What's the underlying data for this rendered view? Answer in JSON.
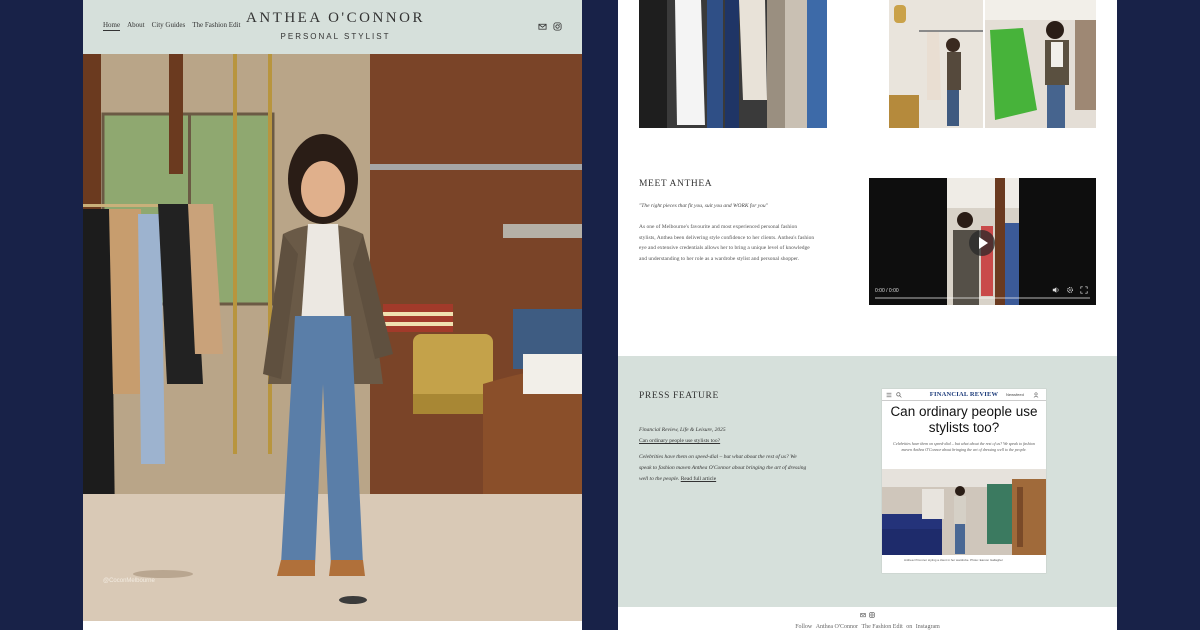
{
  "header": {
    "nav": [
      "Home",
      "About",
      "City Guides",
      "The Fashion Edit"
    ],
    "active_nav": "Home",
    "brand_name": "ANTHEA O'CONNOR",
    "brand_subtitle": "PERSONAL STYLIST",
    "icons": [
      "email-icon",
      "instagram-icon"
    ]
  },
  "hero": {
    "caption": "@CoconMelbourne"
  },
  "meet": {
    "heading": "MEET ANTHEA",
    "quote": "\"The right pieces that fit you, suit you and WORK for you\"",
    "bio": "As one of Melbourne's favourite and most experienced personal fashion stylists, Anthea been delivering style confidence to her clients. Anthea's fashion eye and extensive credentials allows her to bring a unique level of knowledge and understanding to her role as a wardrobe stylist and personal shopper."
  },
  "video": {
    "time": "0:00 / 0:00",
    "progress": 0.0
  },
  "press": {
    "heading": "PRESS FEATURE",
    "source": "Financial Review, Life & Leisure, 2025",
    "article_title_link": "Can ordinary people use stylists too?",
    "description": "Celebrities have them on speed-dial – but what about the rest of us? We speak to fashion maven Anthea O'Connor about bringing the art of dressing well to the people.",
    "read_more": "Read full article",
    "article": {
      "logo": "FINANCIAL REVIEW",
      "newsfeed": "Newsfeed",
      "headline": "Can ordinary people use stylists too?",
      "standfirst": "Celebrities have them on speed-dial – but what about the rest of us? We speak to fashion maven Anthea O'Connor about bringing the art of dressing well to the people.",
      "caption": "Anthea O'Connor styling a client in her wardrobe. Photo: Eamon Gallagher"
    }
  },
  "footer": {
    "links": [
      "Follow",
      "Anthea O'Connor",
      "The Fashion Edit",
      "on",
      "Instagram"
    ]
  },
  "colors": {
    "background": "#182248",
    "header_bg": "#d6e0db",
    "press_bg": "#d6e0db",
    "text": "#333333",
    "ft_blue": "#1c3b7a"
  }
}
